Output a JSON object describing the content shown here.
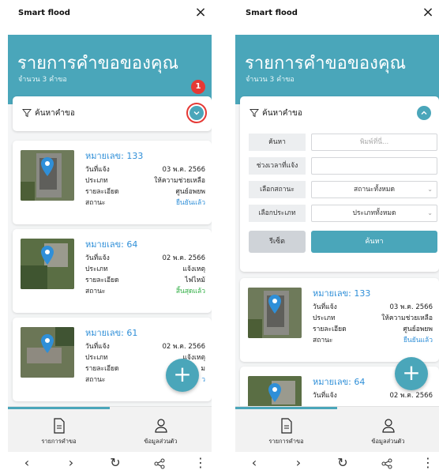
{
  "app_title": "Smart flood",
  "close_glyph": "×",
  "banner": {
    "title": "รายการคำขอของคุณ",
    "subtitle": "จำนวน 3 คำขอ"
  },
  "search_toggle": {
    "label": "ค้นหาคำขอ",
    "collapsed_icon": "chevron-down-icon",
    "expanded_icon": "chevron-up-icon"
  },
  "step_badge": "1",
  "filters": {
    "search": {
      "label": "ค้นหา",
      "placeholder": "พิมพ์ที่นี่..."
    },
    "date_range": {
      "label": "ช่วงเวลาที่แจ้ง",
      "value": ""
    },
    "status": {
      "label": "เลือกสถานะ",
      "value": "สถานะทั้งหมด"
    },
    "type": {
      "label": "เลือกประเภท",
      "value": "ประเภททั้งหมด"
    },
    "reset_label": "รีเซ็ต",
    "search_label": "ค้นหา"
  },
  "field_labels": {
    "date": "วันที่แจ้ง",
    "type": "ประเภท",
    "detail": "รายละเอียด",
    "status": "สถานะ"
  },
  "requests": [
    {
      "title": "หมายเลข: 133",
      "date": "03 พ.ค. 2566",
      "type": "ให้ความช่วยเหลือ",
      "detail": "ศูนย์อพยพ",
      "status": "ยืนยันแล้ว",
      "status_color": "#2f8fd8"
    },
    {
      "title": "หมายเลข: 64",
      "date": "02 พ.ค. 2566",
      "type": "แจ้งเหตุ",
      "detail": "ไฟไหม้",
      "status": "สิ้นสุดแล้ว",
      "status_color": "#2fae43"
    },
    {
      "title": "หมายเลข: 61",
      "date": "02 พ.ค. 2566",
      "type": "แจ้งเหตุ",
      "detail": "ม",
      "status": "ว"
    }
  ],
  "fab_label": "+",
  "tabs": [
    {
      "label": "รายการคำขอ",
      "icon": "document-icon",
      "active": true
    },
    {
      "label": "ข้อมูลส่วนตัว",
      "icon": "person-icon",
      "active": false
    }
  ],
  "nav": {
    "back": "‹",
    "forward": "›",
    "reload": "↻",
    "share": "share-icon",
    "menu": "⋮"
  },
  "colors": {
    "accent": "#4aa6ba",
    "link": "#2f8fd8",
    "success": "#2fae43",
    "highlight": "#e53935"
  }
}
